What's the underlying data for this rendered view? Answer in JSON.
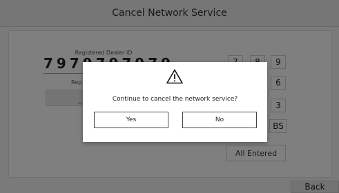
{
  "header": {
    "title": "Cancel Network Service"
  },
  "dealer": {
    "label": "Registered Dealer ID",
    "digits": "7979797979",
    "rep_label": "Rep",
    "rep_value": "_"
  },
  "keypad": {
    "row1": [
      "7",
      "8",
      "9"
    ],
    "row2": [
      "6"
    ],
    "row3": [
      "3"
    ],
    "backspace": "BS",
    "all_entered": "All Entered"
  },
  "footer": {
    "back_label": "Back"
  },
  "dialog": {
    "icon": "warning-icon",
    "message": "Continue to cancel the network service?",
    "yes_label": "Yes",
    "no_label": "No"
  },
  "colors": {
    "overlay": "#000000",
    "dialog_bg": "#ffffff"
  }
}
